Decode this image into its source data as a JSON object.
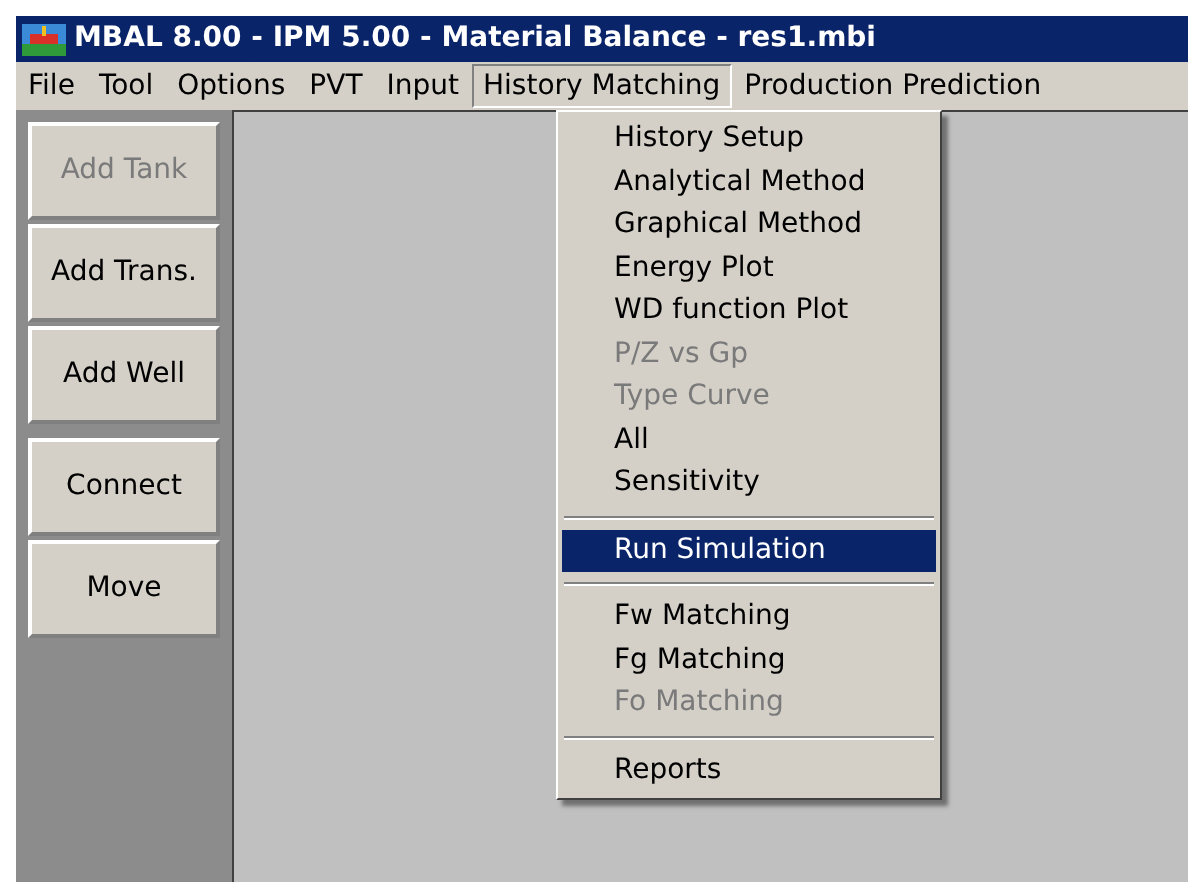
{
  "window": {
    "title": "MBAL 8.00 - IPM 5.00 - Material Balance - res1.mbi"
  },
  "menu_bar": [
    {
      "label": "File",
      "selected": false
    },
    {
      "label": "Tool",
      "selected": false
    },
    {
      "label": "Options",
      "selected": false
    },
    {
      "label": "PVT",
      "selected": false
    },
    {
      "label": "Input",
      "selected": false
    },
    {
      "label": "History Matching",
      "selected": true
    },
    {
      "label": "Production Prediction",
      "selected": false
    }
  ],
  "toolbar": [
    {
      "label": "Add Tank",
      "disabled": true
    },
    {
      "label": "Add Trans.",
      "disabled": false
    },
    {
      "label": "Add Well",
      "disabled": false
    },
    {
      "label": "Connect",
      "disabled": false
    },
    {
      "label": "Move",
      "disabled": false
    }
  ],
  "dropdown": [
    {
      "kind": "item",
      "label": "History Setup",
      "disabled": false,
      "selected": false
    },
    {
      "kind": "item",
      "label": "Analytical Method",
      "disabled": false,
      "selected": false
    },
    {
      "kind": "item",
      "label": "Graphical Method",
      "disabled": false,
      "selected": false
    },
    {
      "kind": "item",
      "label": "Energy Plot",
      "disabled": false,
      "selected": false
    },
    {
      "kind": "item",
      "label": "WD function Plot",
      "disabled": false,
      "selected": false
    },
    {
      "kind": "item",
      "label": "P/Z vs Gp",
      "disabled": true,
      "selected": false
    },
    {
      "kind": "item",
      "label": "Type Curve",
      "disabled": true,
      "selected": false
    },
    {
      "kind": "item",
      "label": "All",
      "disabled": false,
      "selected": false
    },
    {
      "kind": "item",
      "label": "Sensitivity",
      "disabled": false,
      "selected": false
    },
    {
      "kind": "separator"
    },
    {
      "kind": "item",
      "label": "Run Simulation",
      "disabled": false,
      "selected": true
    },
    {
      "kind": "separator"
    },
    {
      "kind": "item",
      "label": "Fw Matching",
      "disabled": false,
      "selected": false
    },
    {
      "kind": "item",
      "label": "Fg Matching",
      "disabled": false,
      "selected": false
    },
    {
      "kind": "item",
      "label": "Fo Matching",
      "disabled": true,
      "selected": false
    },
    {
      "kind": "separator"
    },
    {
      "kind": "item",
      "label": "Reports",
      "disabled": false,
      "selected": false
    }
  ]
}
